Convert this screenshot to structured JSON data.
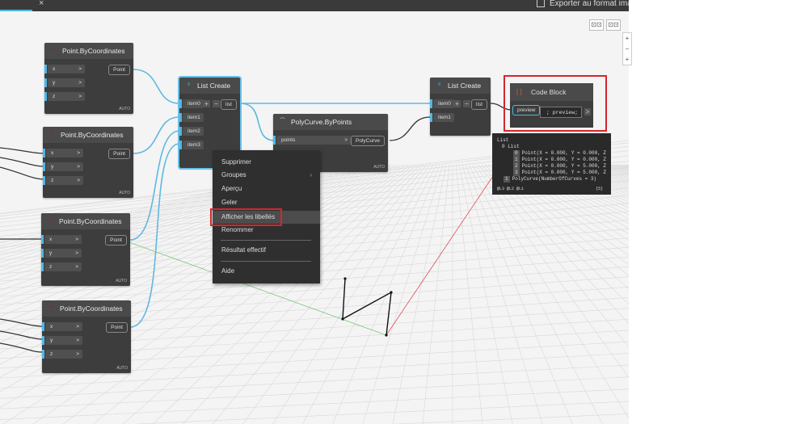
{
  "toolbar": {
    "close_symbol": "×",
    "export_label": "Exporter au format image"
  },
  "view_controls": [
    "⊡⊡",
    "⊡⊡"
  ],
  "zoom_controls": [
    "+",
    "−",
    "+"
  ],
  "nodes": {
    "p1": {
      "title": "Point.ByCoordinates",
      "inputs": [
        "x",
        "y",
        "z"
      ],
      "output": "Point",
      "foot": "AUTO"
    },
    "p2": {
      "title": "Point.ByCoordinates",
      "inputs": [
        "x",
        "y",
        "z"
      ],
      "output": "Point",
      "foot": "AUTO"
    },
    "p3": {
      "title": "Point.ByCoordinates",
      "inputs": [
        "x",
        "y",
        "z"
      ],
      "output": "Point",
      "foot": "AUTO"
    },
    "p4": {
      "title": "Point.ByCoordinates",
      "inputs": [
        "x",
        "y",
        "z"
      ],
      "output": "Point",
      "foot": "AUTO"
    },
    "lc1": {
      "title": "List Create",
      "inputs": [
        "item0",
        "item1",
        "item2",
        "item3"
      ],
      "output": "list"
    },
    "poly": {
      "title": "PolyCurve.ByPoints",
      "inputs": [
        "points"
      ],
      "output": "PolyCurve",
      "foot": "AUTO"
    },
    "lc2": {
      "title": "List Create",
      "inputs": [
        "item0",
        "item1"
      ],
      "output": "list"
    },
    "cb": {
      "title": "Code Block",
      "brackets": "[ ]",
      "port": "preview",
      "code": "; preview;"
    }
  },
  "context_menu": {
    "items": [
      {
        "label": "Supprimer"
      },
      {
        "label": "Groupes",
        "submenu": "›"
      },
      {
        "label": "Aperçu"
      },
      {
        "label": "Geler"
      },
      {
        "label": "Afficher les libellés",
        "highlighted": true
      },
      {
        "label": "Renommer"
      },
      {
        "label": "Résultat effectif"
      },
      {
        "label": "Aide"
      }
    ]
  },
  "preview": {
    "root": "List",
    "sub": "0 List",
    "rows": [
      {
        "idx": "0",
        "text": "Point(X = 0.000, Y = 0.000, Z"
      },
      {
        "idx": "1",
        "text": "Point(X = 0.000, Y = 0.000, Z"
      },
      {
        "idx": "2",
        "text": "Point(X = 0.000, Y = 5.000, Z"
      },
      {
        "idx": "3",
        "text": "Point(X = 0.000, Y = 5.000, Z"
      }
    ],
    "poly_idx": "1",
    "poly_text": "PolyCurve(NumberOfCurves = 3)",
    "levels": "@L3 @L2 @L1",
    "count": "{5}"
  },
  "colors": {
    "wire": "#5fb8e0",
    "highlight_box": "#d4262c"
  }
}
